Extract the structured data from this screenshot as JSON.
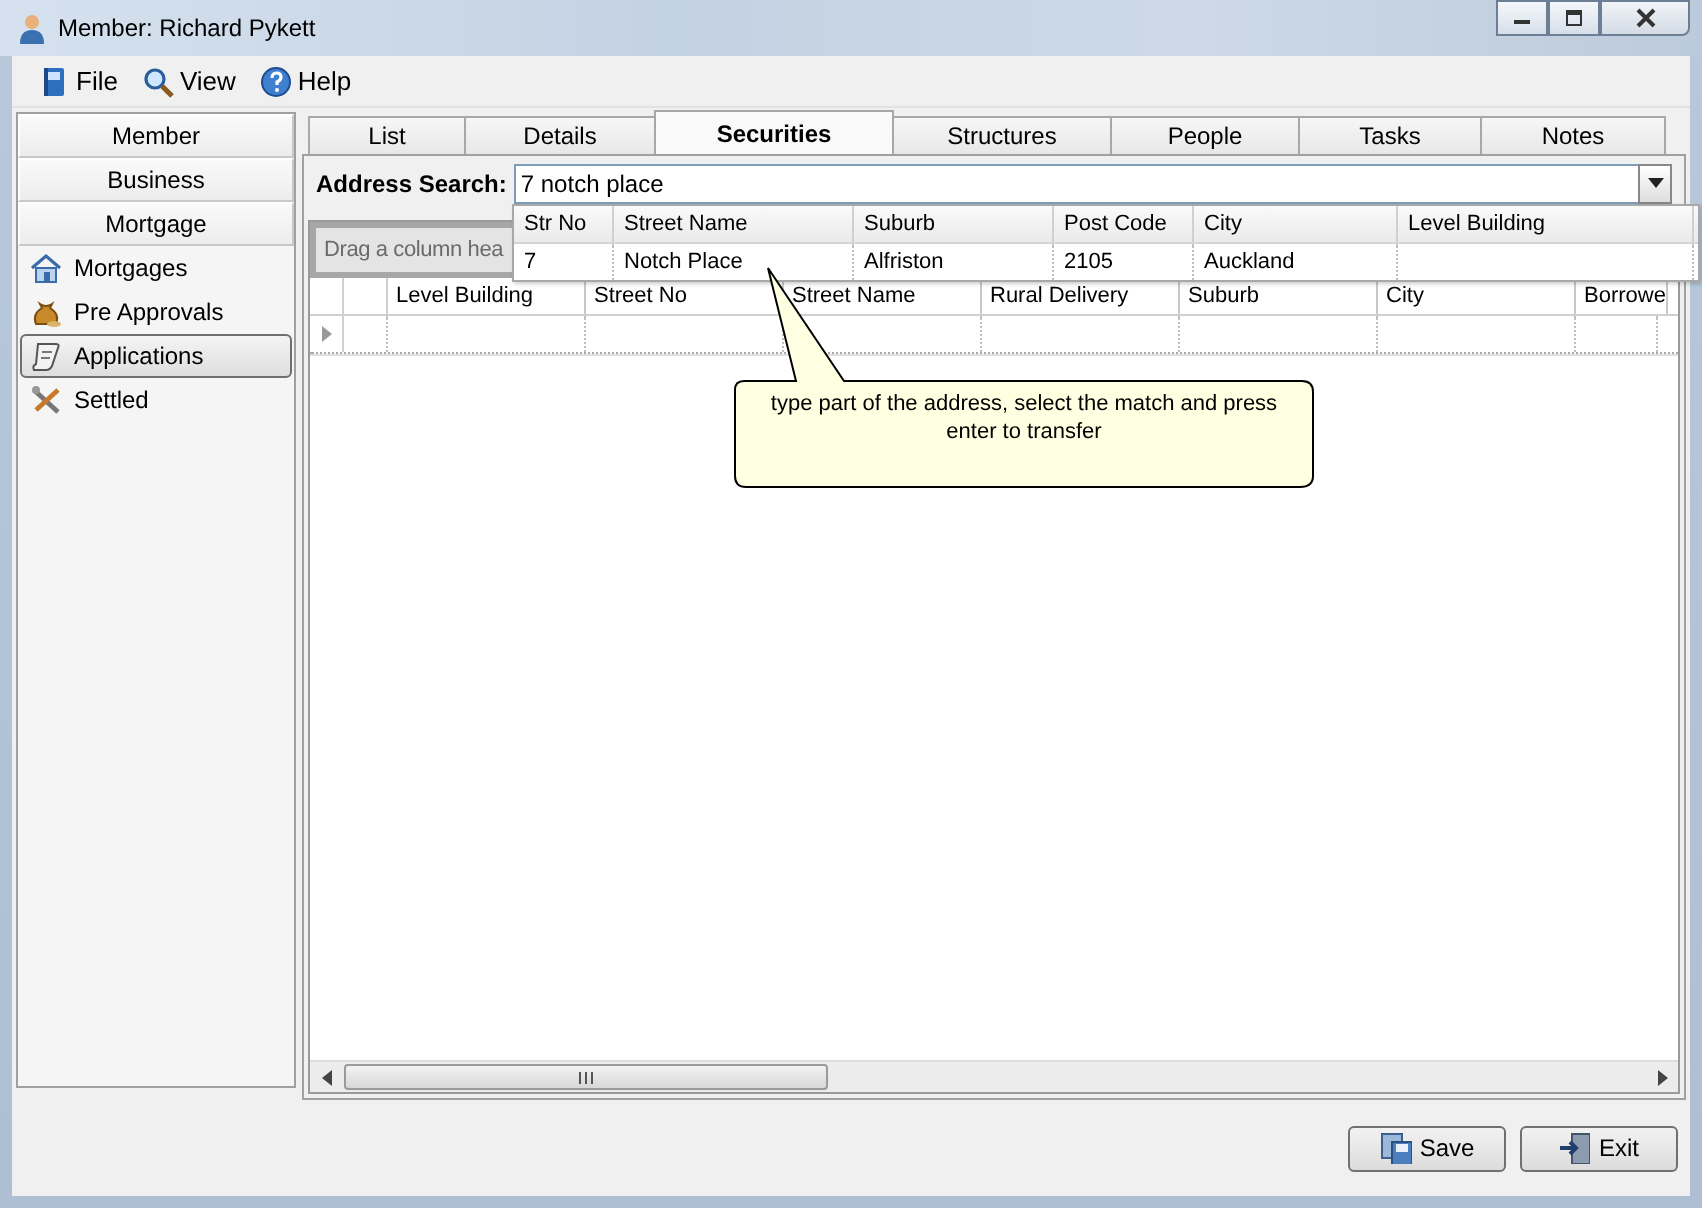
{
  "window": {
    "title": "Member: Richard Pykett"
  },
  "menu": [
    {
      "label": "File"
    },
    {
      "label": "View"
    },
    {
      "label": "Help"
    }
  ],
  "sidebar": {
    "sections": [
      "Member",
      "Business",
      "Mortgage"
    ],
    "items": [
      {
        "label": "Mortgages",
        "selected": false
      },
      {
        "label": "Pre Approvals",
        "selected": false
      },
      {
        "label": "Applications",
        "selected": true
      },
      {
        "label": "Settled",
        "selected": false
      }
    ]
  },
  "tabs": [
    {
      "label": "List",
      "selected": false
    },
    {
      "label": "Details",
      "selected": false
    },
    {
      "label": "Securities",
      "selected": true
    },
    {
      "label": "Structures",
      "selected": false
    },
    {
      "label": "People",
      "selected": false
    },
    {
      "label": "Tasks",
      "selected": false
    },
    {
      "label": "Notes",
      "selected": false
    }
  ],
  "address_search": {
    "label": "Address Search:",
    "value": "7 notch place"
  },
  "dropdown": {
    "columns": [
      "Str No",
      "Street Name",
      "Suburb",
      "Post Code",
      "City",
      "Level Building"
    ],
    "rows": [
      [
        "7",
        "Notch Place",
        "Alfriston",
        "2105",
        "Auckland",
        ""
      ]
    ]
  },
  "group_panel": {
    "text": "Drag a column hea"
  },
  "grid": {
    "columns": [
      "Level Building",
      "Street No",
      "Street Name",
      "Rural Delivery",
      "Suburb",
      "City",
      "Borrowe"
    ]
  },
  "callout": {
    "text": "type part of the address, select the match and press enter to transfer"
  },
  "buttons": [
    {
      "label": "Save"
    },
    {
      "label": "Exit"
    }
  ]
}
